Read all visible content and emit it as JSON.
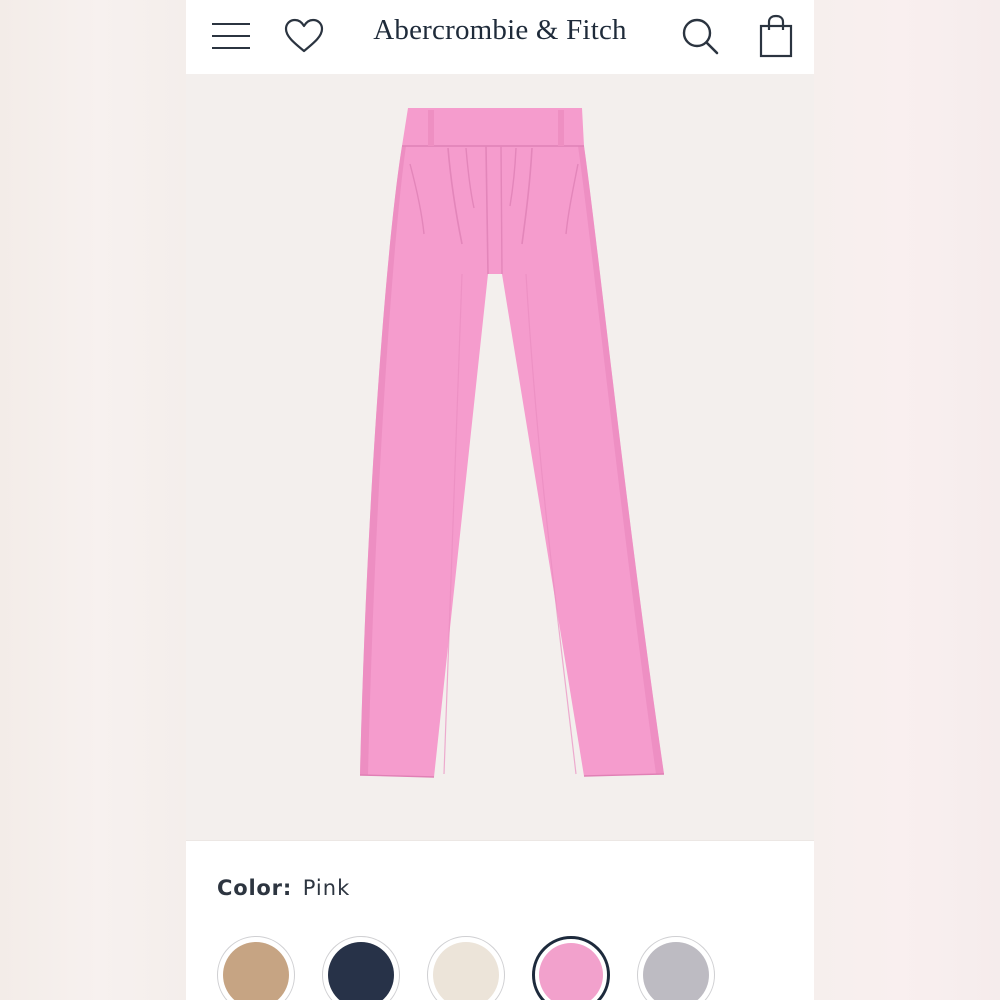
{
  "header": {
    "brand": "Abercrombie & Fitch",
    "icons": [
      "menu-icon",
      "heart-icon",
      "search-icon",
      "shopping-bag-icon"
    ],
    "icon_color": "#2b3440"
  },
  "product": {
    "image": "pink wide-leg pleated trousers",
    "garment_color": "#f59ccd"
  },
  "color_selector": {
    "label": "Color:",
    "selected": "Pink",
    "swatches": [
      {
        "color": "#c6a483",
        "selected": false
      },
      {
        "color": "#273248",
        "selected": false
      },
      {
        "color": "#ece4d9",
        "selected": false
      },
      {
        "color": "#f2a1cc",
        "selected": true
      },
      {
        "color": "#bdbbc2",
        "selected": false
      }
    ]
  }
}
